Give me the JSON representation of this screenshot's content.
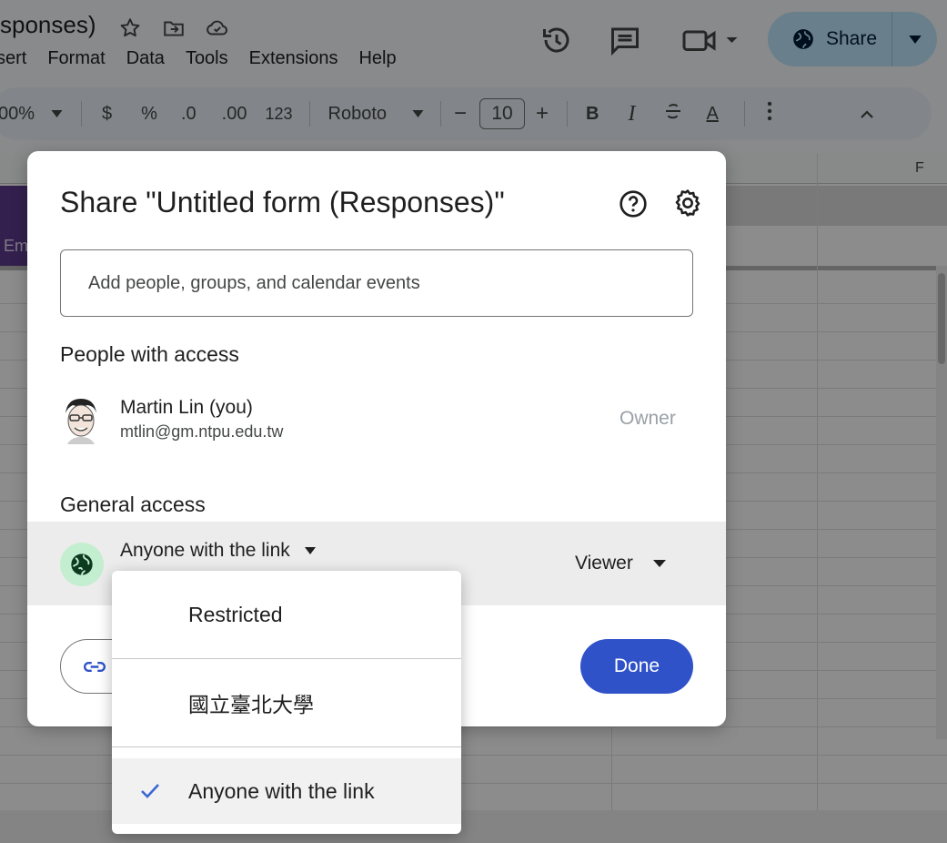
{
  "app": {
    "title_fragment": "sponses)",
    "menus": [
      "sert",
      "Format",
      "Data",
      "Tools",
      "Extensions",
      "Help"
    ],
    "share_label": "Share"
  },
  "toolbar": {
    "zoom": "00%",
    "currency": "$",
    "percent": "%",
    "dec_decrease": ".0",
    "dec_increase": ".00",
    "number_format": "123",
    "font": "Roboto",
    "font_size": "10",
    "minus": "−",
    "plus": "+",
    "bold": "B",
    "italic": "I",
    "text_color": "A"
  },
  "grid": {
    "col_f": "F",
    "cell_label": "Em"
  },
  "dialog": {
    "title": "Share \"Untitled form (Responses)\"",
    "add_placeholder": "Add people, groups, and calendar events",
    "people_heading": "People with access",
    "person": {
      "name": "Martin Lin (you)",
      "email": "mtlin@gm.ntpu.edu.tw",
      "role": "Owner"
    },
    "general_heading": "General access",
    "general_access_value": "Anyone with the link",
    "viewer_label": "Viewer",
    "done_label": "Done"
  },
  "menu": {
    "items": [
      "Restricted",
      "國立臺北大學",
      "Anyone with the link"
    ],
    "selected": "Anyone with the link"
  },
  "colors": {
    "share_button_bg": "#c2e7ff",
    "done_button_bg": "#3052c9",
    "globe_circle_bg": "#c4eed0",
    "check_color": "#3b66d6"
  }
}
